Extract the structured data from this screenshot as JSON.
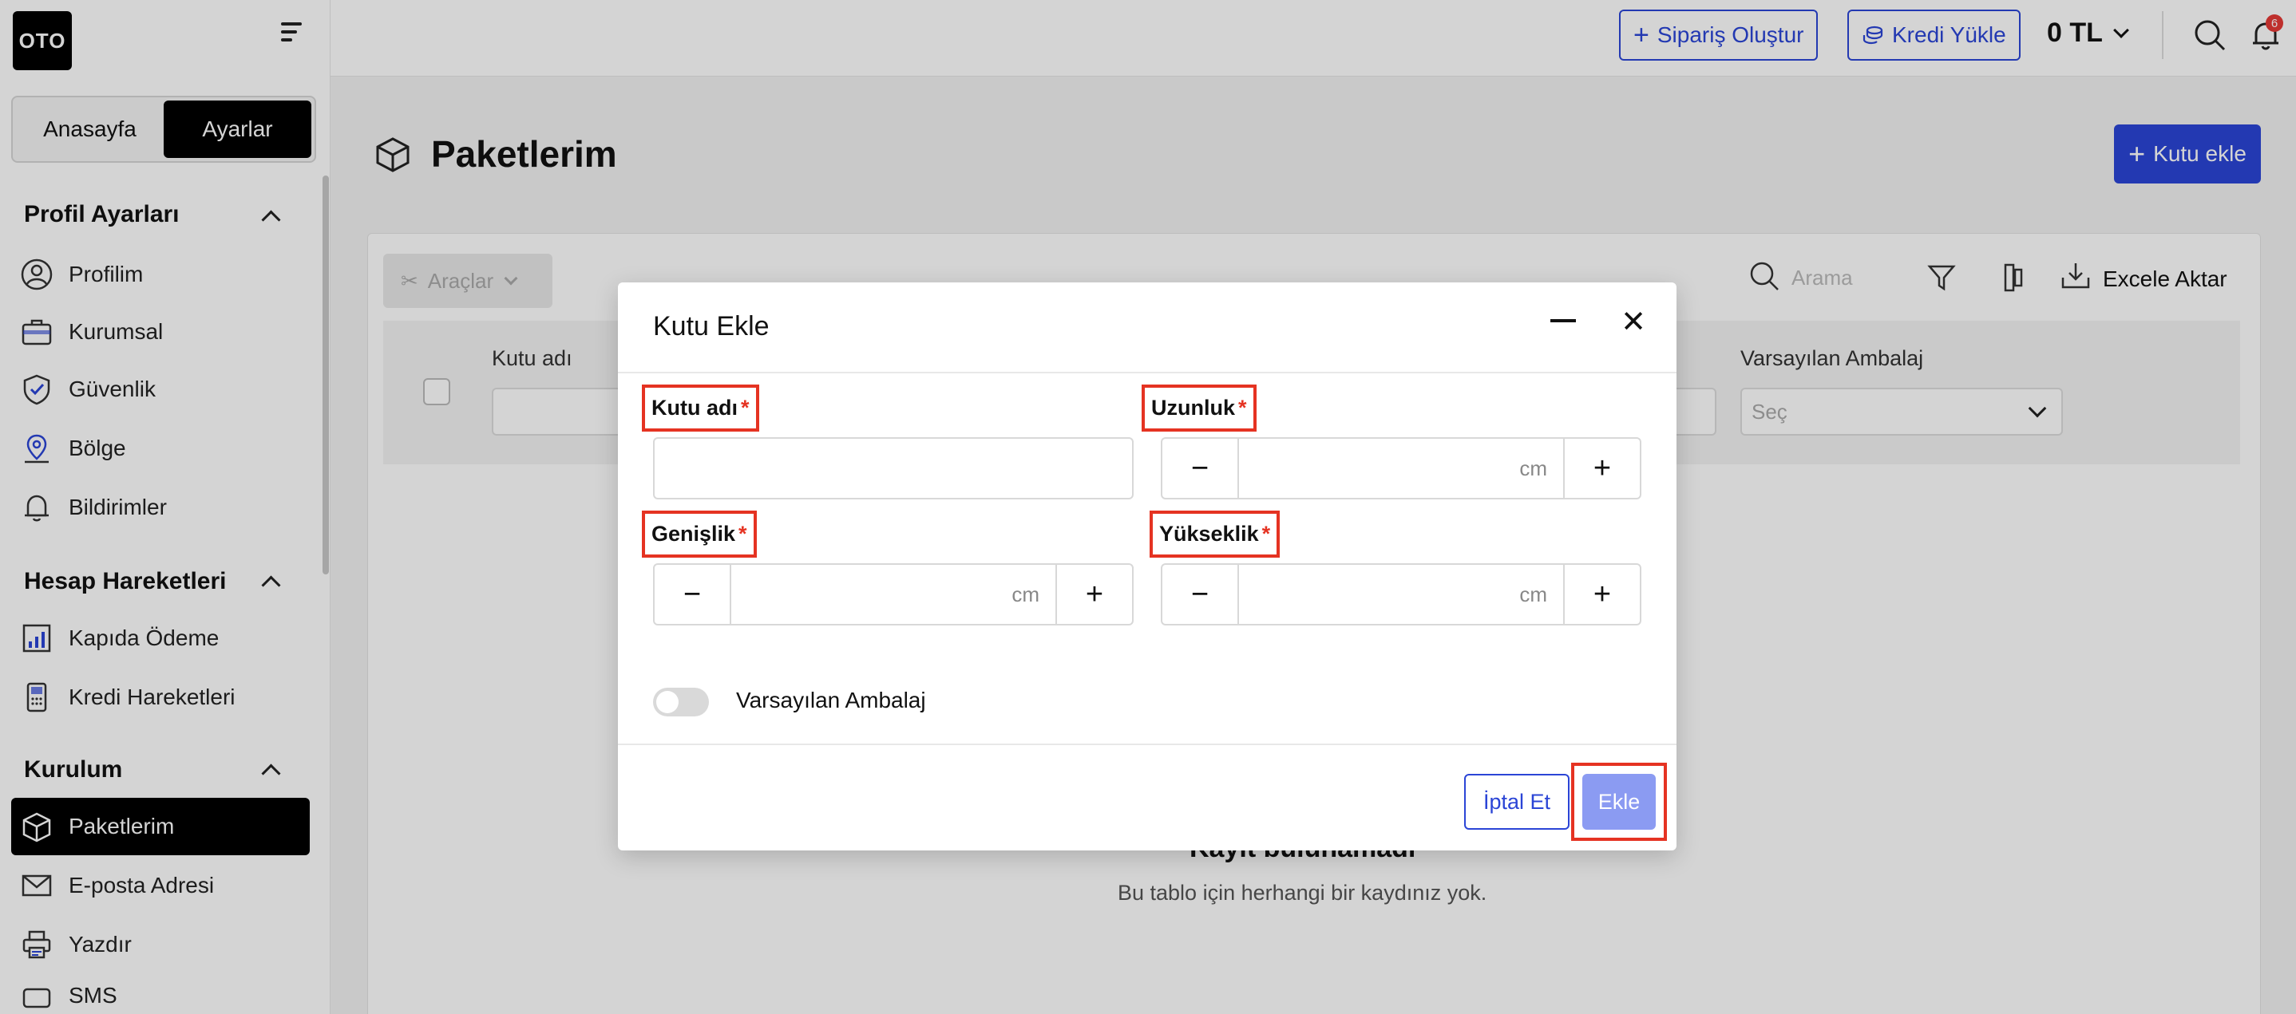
{
  "sidebar": {
    "logo": "OTO",
    "tabs": {
      "home": "Anasayfa",
      "settings": "Ayarlar"
    },
    "sections": [
      {
        "title": "Profil Ayarları",
        "items": [
          "Profilim",
          "Kurumsal",
          "Güvenlik",
          "Bölge",
          "Bildirimler"
        ]
      },
      {
        "title": "Hesap Hareketleri",
        "items": [
          "Kapıda Ödeme",
          "Kredi Hareketleri"
        ]
      },
      {
        "title": "Kurulum",
        "items": [
          "Paketlerim",
          "E-posta Adresi",
          "Yazdır",
          "SMS"
        ]
      }
    ]
  },
  "topbar": {
    "create_order": "Sipariş Oluştur",
    "load_credit": "Kredi Yükle",
    "balance": "0 TL",
    "notification_count": "6"
  },
  "main": {
    "title": "Paketlerim",
    "add_box": "Kutu ekle",
    "tools": "Araçlar",
    "search_placeholder": "Arama",
    "export": "Excele Aktar",
    "columns": {
      "box_name": "Kutu adı",
      "default_packaging": "Varsayılan Ambalaj"
    },
    "select_placeholder": "Seç",
    "empty_title": "Kayıt bulunamadı",
    "empty_desc": "Bu tablo için herhangi bir kaydınız yok."
  },
  "modal": {
    "title": "Kutu Ekle",
    "fields": {
      "box_name": "Kutu adı",
      "length": "Uzunluk",
      "width": "Genişlik",
      "height": "Yükseklik"
    },
    "required_mark": "*",
    "unit": "cm",
    "default_packaging": "Varsayılan Ambalaj",
    "cancel": "İptal Et",
    "add": "Ekle"
  }
}
